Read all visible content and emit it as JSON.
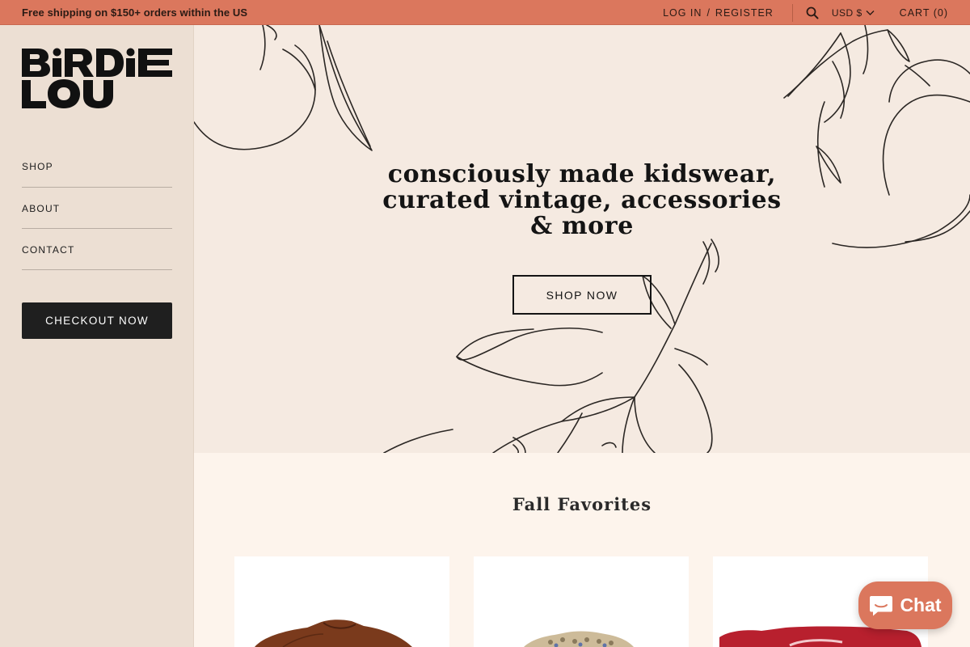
{
  "announcement": {
    "text": "Free shipping on $150+ orders within the US"
  },
  "header": {
    "login_label": "LOG IN",
    "separator": "/",
    "register_label": "REGISTER",
    "search_icon": "search-icon",
    "currency": "USD $",
    "cart_label": "CART (0)"
  },
  "brand": {
    "logo_line1": "BiRDiE",
    "logo_line2": "LOU"
  },
  "sidebar": {
    "nav": [
      {
        "label": "SHOP"
      },
      {
        "label": "ABOUT"
      },
      {
        "label": "CONTACT"
      }
    ],
    "checkout_label": "CHECKOUT NOW"
  },
  "hero": {
    "headline_line1": "consciously made kidswear,",
    "headline_line2": "curated vintage, accessories",
    "headline_line3": "& more",
    "cta_label": "SHOP NOW"
  },
  "collection": {
    "title": "Fall Favorites",
    "products": [
      {
        "image": "brown-jacket-image"
      },
      {
        "image": "knit-cardigan-image"
      },
      {
        "image": "red-sweatshirt-image"
      }
    ]
  },
  "chat": {
    "label": "Chat",
    "icon": "chat-bubble-icon"
  },
  "colors": {
    "accent": "#db775d",
    "sidebar_bg": "#ecdfd3",
    "hero_bg": "#f5eae1",
    "page_bg": "#fdf4ec",
    "dark": "#1f1f1f"
  }
}
